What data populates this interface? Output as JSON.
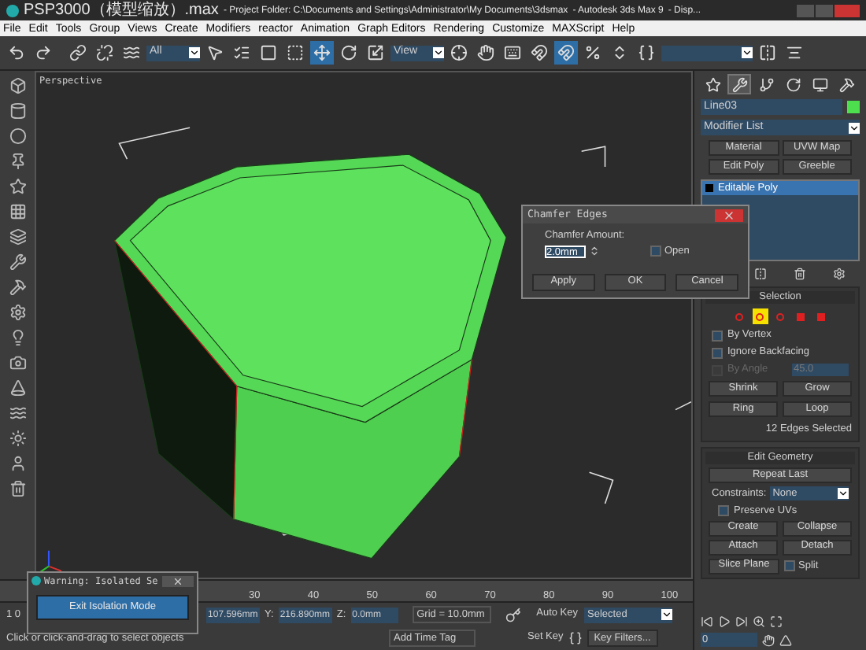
{
  "title_bar": {
    "file": "PSP3000（模型缩放）.max",
    "project": "- Project Folder: C:\\Documents and Settings\\Administrator\\My Documents\\3dsmax",
    "app": "- Autodesk 3ds Max 9",
    "extra": "- Disp..."
  },
  "menu": [
    "File",
    "Edit",
    "Tools",
    "Group",
    "Views",
    "Create",
    "Modifiers",
    "reactor",
    "Animation",
    "Graph Editors",
    "Rendering",
    "Customize",
    "MAXScript",
    "Help"
  ],
  "toolbar": [
    {
      "kind": "button",
      "selected": false
    },
    {
      "kind": "button",
      "selected": false
    },
    {
      "kind": "gap"
    },
    {
      "kind": "button",
      "selected": false
    },
    {
      "kind": "button",
      "selected": false
    },
    {
      "kind": "button",
      "selected": false
    },
    {
      "kind": "dropdown",
      "value": "All"
    },
    {
      "kind": "button",
      "selected": false
    },
    {
      "kind": "button",
      "selected": false
    },
    {
      "kind": "button",
      "selected": false
    },
    {
      "kind": "button",
      "selected": false
    },
    {
      "kind": "button",
      "selected": true
    },
    {
      "kind": "button",
      "selected": false
    },
    {
      "kind": "button",
      "selected": false
    },
    {
      "kind": "dropdown",
      "value": "View"
    },
    {
      "kind": "button",
      "selected": false
    },
    {
      "kind": "button",
      "selected": false
    },
    {
      "kind": "button",
      "selected": false
    },
    {
      "kind": "button",
      "selected": false
    },
    {
      "kind": "button",
      "selected": true
    },
    {
      "kind": "button",
      "selected": false
    },
    {
      "kind": "button",
      "selected": false
    },
    {
      "kind": "button",
      "selected": false
    },
    {
      "kind": "field"
    },
    {
      "kind": "button",
      "selected": false
    },
    {
      "kind": "button",
      "selected": false
    }
  ],
  "viewport": {
    "label": "Perspective"
  },
  "chamfer_dialog": {
    "title": "Chamfer Edges",
    "amount_label": "Chamfer Amount:",
    "amount": "2.0mm",
    "open": {
      "label": "Open",
      "checked": false
    },
    "buttons": [
      "Apply",
      "OK",
      "Cancel"
    ]
  },
  "command_panel": {
    "tabs": [
      {
        "selected": false
      },
      {
        "selected": true
      },
      {
        "selected": false
      },
      {
        "selected": false
      },
      {
        "selected": false
      },
      {
        "selected": false
      }
    ],
    "object_name": "Line03",
    "modifier_list": "Modifier List",
    "modifier_buttons": [
      "Material",
      "UVW Map",
      "Edit Poly",
      "Greeble"
    ],
    "stack": [
      {
        "label": "Editable Poly",
        "selected": true
      }
    ],
    "selection": {
      "title": "Selection",
      "levels": [
        {
          "selected": false
        },
        {
          "selected": true
        },
        {
          "selected": false
        },
        {
          "selected": false
        },
        {
          "selected": false
        }
      ],
      "checkboxes": [
        {
          "label": "By Vertex",
          "checked": false,
          "disabled": false
        },
        {
          "label": "Ignore Backfacing",
          "checked": false,
          "disabled": false
        },
        {
          "label": "By Angle",
          "checked": false,
          "disabled": true
        }
      ],
      "angle": "45.0",
      "buttons": [
        [
          "Shrink",
          "Grow"
        ],
        [
          "Ring",
          "Loop"
        ]
      ],
      "status": "12 Edges Selected"
    },
    "edit_geometry": {
      "title": "Edit Geometry",
      "repeat": "Repeat Last",
      "constraints_label": "Constraints:",
      "constraints": "None",
      "preserve_uvs": {
        "label": "Preserve UVs",
        "checked": false
      },
      "buttons": [
        [
          "Create",
          "Collapse"
        ],
        [
          "Attach",
          "Detach"
        ]
      ],
      "slice_plane": "Slice Plane",
      "split": {
        "label": "Split",
        "checked": false
      }
    },
    "frame": "0"
  },
  "warning_dialog": {
    "title": "Warning: Isolated Se",
    "button": "Exit Isolation Mode"
  },
  "timeline": {
    "ticks": [
      "30",
      "40",
      "50",
      "60",
      "70",
      "80",
      "90",
      "100"
    ]
  },
  "status_bar": {
    "frame_info": "1 0",
    "x": "107.596mm",
    "y_label": "Y:",
    "y": "216.890mm",
    "z_label": "Z:",
    "z": "0.0mm",
    "grid": "Grid = 10.0mm",
    "auto_key": "Auto Key",
    "key_mode": "Selected",
    "prompt": "Click or click-and-drag to select objects",
    "add_time_tag": "Add Time Tag",
    "set_key": "Set Key",
    "key_filters": "Key Filters..."
  }
}
